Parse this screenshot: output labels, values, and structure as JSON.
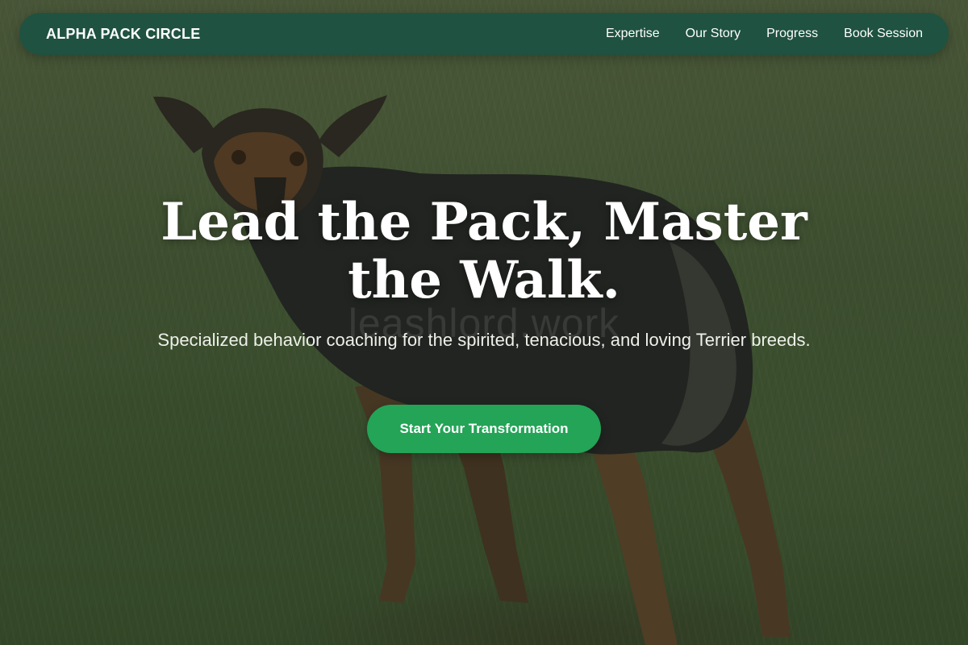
{
  "nav": {
    "brand": "ALPHA PACK CIRCLE",
    "links": [
      "Expertise",
      "Our Story",
      "Progress",
      "Book Session"
    ]
  },
  "hero": {
    "headline": "Lead the Pack, Master the Walk.",
    "subheadline": "Specialized behavior coaching for the spirited, tenacious, and loving Terrier breeds.",
    "cta_label": "Start Your Transformation",
    "watermark": "leashlord.work"
  },
  "colors": {
    "nav_background": "#1f5240",
    "cta_background": "#23a456",
    "text": "#ffffff"
  }
}
